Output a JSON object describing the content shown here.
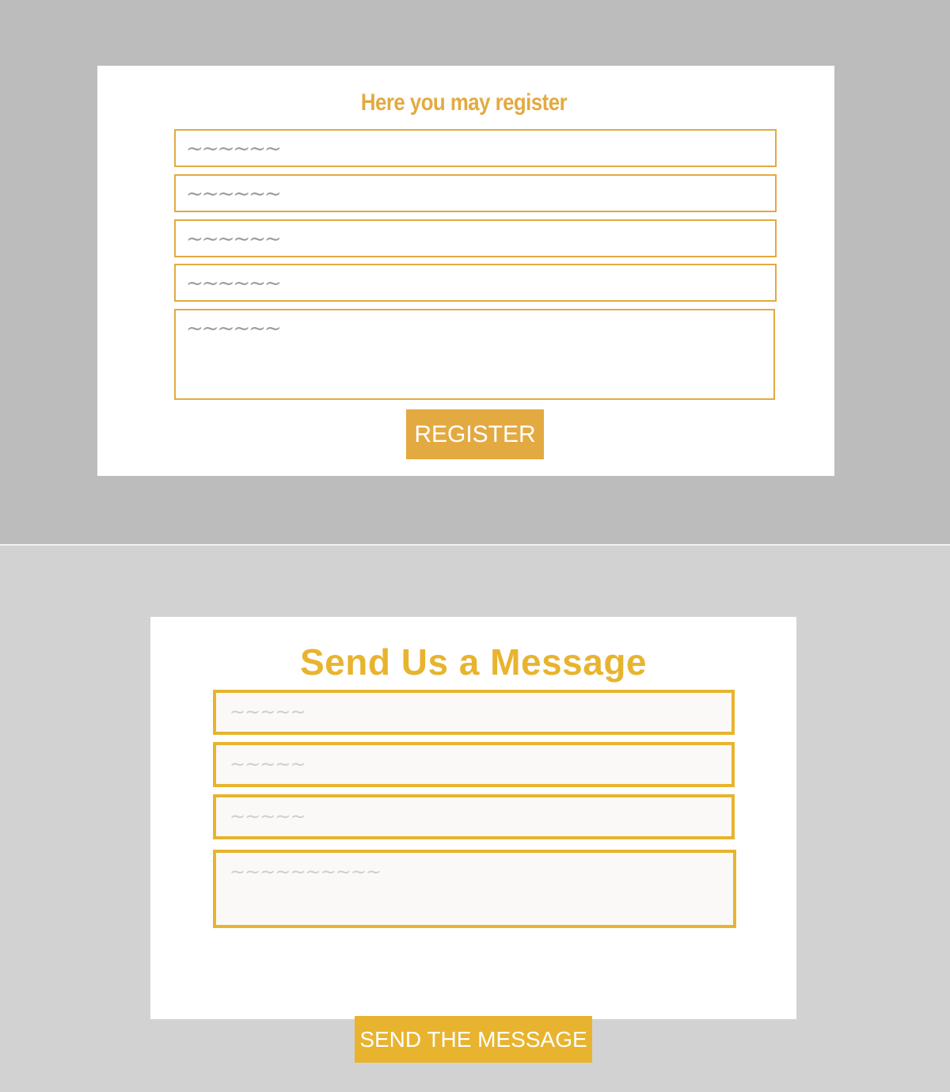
{
  "register_form": {
    "title": "Here you may register",
    "fields": [
      {
        "placeholder": "~~~~~~"
      },
      {
        "placeholder": "~~~~~~"
      },
      {
        "placeholder": "~~~~~~"
      },
      {
        "placeholder": "~~~~~~"
      }
    ],
    "textarea_placeholder": "~~~~~~",
    "button_label": "REGISTER",
    "accent_color": "#e3aa41"
  },
  "message_form": {
    "title": "Send Us a Message",
    "fields": [
      {
        "placeholder": "~~~~~"
      },
      {
        "placeholder": "~~~~~"
      },
      {
        "placeholder": "~~~~~"
      }
    ],
    "textarea_placeholder": "~~~~~~~~~~",
    "button_label": "SEND THE MESSAGE",
    "accent_color": "#e8b42f"
  }
}
